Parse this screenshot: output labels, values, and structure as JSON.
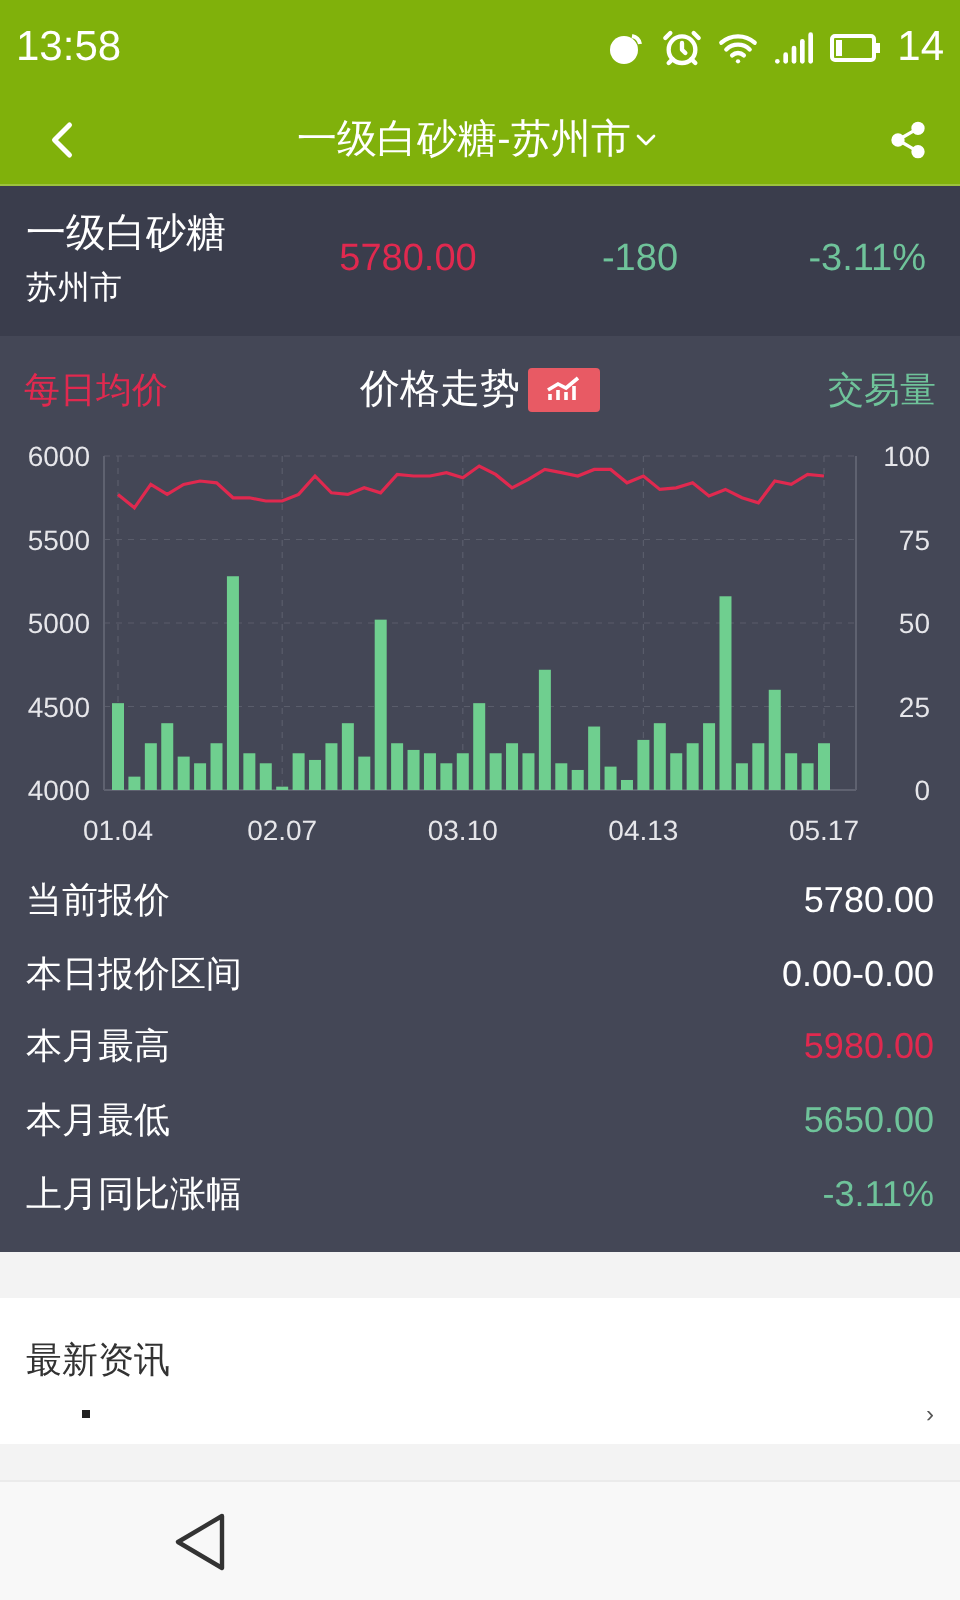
{
  "status_bar": {
    "time": "13:58",
    "battery": "14"
  },
  "header": {
    "title": "一级白砂糖-苏州市"
  },
  "summary": {
    "name": "一级白砂糖",
    "city": "苏州市",
    "price": {
      "text": "5780.00",
      "color": "#e0294f"
    },
    "change": {
      "text": "-180",
      "color": "#6fc39a"
    },
    "percent": {
      "text": "-3.11%",
      "color": "#6fc39a"
    }
  },
  "chart_section": {
    "title": "价格走势",
    "price_chart": {
      "chart_data": {
        "type": "line",
        "ylim": [
          4000,
          6000
        ],
        "yticks": [
          4000,
          4500,
          5000,
          5500,
          6000
        ],
        "series": [
          {
            "name": "每日均价",
            "color": "#e0294f",
            "values": [
              5770,
              5690,
              5830,
              5770,
              5830,
              5850,
              5840,
              5750,
              5750,
              5730,
              5730,
              5770,
              5880,
              5780,
              5770,
              5810,
              5780,
              5890,
              5880,
              5880,
              5900,
              5870,
              5940,
              5890,
              5810,
              5860,
              5920,
              5900,
              5880,
              5920,
              5920,
              5840,
              5880,
              5800,
              5810,
              5840,
              5760,
              5800,
              5750,
              5720,
              5850,
              5830,
              5890,
              5880
            ]
          }
        ]
      }
    },
    "volume_chart": {
      "chart_data": {
        "type": "bar",
        "categories": [
          "01.04",
          null,
          null,
          null,
          null,
          null,
          null,
          null,
          null,
          null,
          "02.07",
          null,
          null,
          null,
          null,
          null,
          null,
          null,
          null,
          null,
          null,
          "03.10",
          null,
          null,
          null,
          null,
          null,
          null,
          null,
          null,
          null,
          null,
          "04.13",
          null,
          null,
          null,
          null,
          null,
          null,
          null,
          null,
          null,
          null,
          "05.17"
        ],
        "grid": true,
        "ylim": [
          0,
          100
        ],
        "yticks": [
          0,
          25,
          50,
          75,
          100
        ],
        "series": [
          {
            "name": "交易量",
            "color": "#6fcf8f",
            "values": [
              26,
              4,
              14,
              20,
              10,
              8,
              14,
              64,
              11,
              8,
              1,
              11,
              9,
              14,
              20,
              10,
              51,
              14,
              12,
              11,
              8,
              11,
              26,
              11,
              14,
              11,
              36,
              8,
              6,
              19,
              7,
              3,
              15,
              20,
              11,
              14,
              20,
              58,
              8,
              14,
              30,
              11,
              8,
              14
            ]
          }
        ]
      }
    }
  },
  "stats": [
    {
      "label": "当前报价",
      "value": "5780.00",
      "color": "#ffffff"
    },
    {
      "label": "本日报价区间",
      "value": "0.00-0.00",
      "color": "#ffffff"
    },
    {
      "label": "本月最高",
      "value": "5980.00",
      "color": "#e0294f"
    },
    {
      "label": "本月最低",
      "value": "5650.00",
      "color": "#6fc39a"
    },
    {
      "label": "上月同比涨幅",
      "value": "-3.11%",
      "color": "#6fc39a"
    }
  ],
  "news": {
    "title": "最新资讯",
    "more": "›"
  }
}
